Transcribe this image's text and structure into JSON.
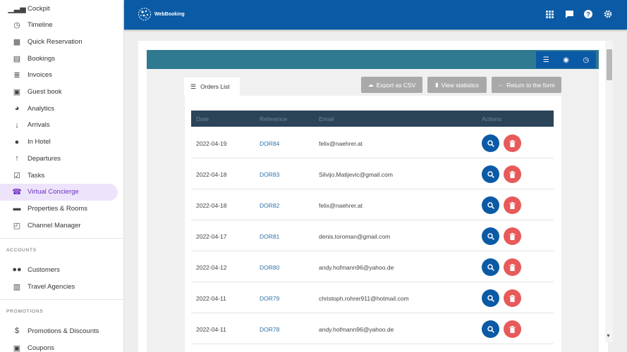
{
  "sidebar": {
    "items": [
      {
        "label": "Cockpit",
        "icon": "bar-chart-icon",
        "glyph": "▁▃▅"
      },
      {
        "label": "Timeline",
        "icon": "clock-icon",
        "glyph": "◷"
      },
      {
        "label": "Quick Reservation",
        "icon": "calendar-icon",
        "glyph": "▦"
      },
      {
        "label": "Bookings",
        "icon": "book-icon",
        "glyph": "▤"
      },
      {
        "label": "Invoices",
        "icon": "invoice-icon",
        "glyph": "≣"
      },
      {
        "label": "Guest book",
        "icon": "guestbook-icon",
        "glyph": "▣"
      },
      {
        "label": "Analytics",
        "icon": "pie-chart-icon",
        "glyph": "◕"
      },
      {
        "label": "Arrivals",
        "icon": "arrow-down-icon",
        "glyph": "↓"
      },
      {
        "label": "In Hotel",
        "icon": "location-pin-icon",
        "glyph": "●"
      },
      {
        "label": "Departures",
        "icon": "arrow-up-icon",
        "glyph": "↑"
      },
      {
        "label": "Tasks",
        "icon": "checklist-icon",
        "glyph": "☑"
      },
      {
        "label": "Virtual Concierge",
        "icon": "concierge-icon",
        "glyph": "☎"
      },
      {
        "label": "Properties & Rooms",
        "icon": "bed-icon",
        "glyph": "▬"
      },
      {
        "label": "Channel Manager",
        "icon": "cast-icon",
        "glyph": "◰"
      }
    ],
    "accounts_label": "ACCOUNTS",
    "accounts": [
      {
        "label": "Customers",
        "icon": "people-icon",
        "glyph": "●●"
      },
      {
        "label": "Travel Agencies",
        "icon": "building-icon",
        "glyph": "▥"
      }
    ],
    "promotions_label": "PROMOTIONS",
    "promotions": [
      {
        "label": "Promotions & Discounts",
        "icon": "dollar-icon",
        "glyph": "$"
      },
      {
        "label": "Coupons",
        "icon": "coupon-icon",
        "glyph": "▣"
      }
    ]
  },
  "header": {
    "logo_text": "WebBooking",
    "icons": [
      "apps-grid-icon",
      "feedback-icon",
      "help-icon",
      "settings-gear-icon"
    ],
    "glyphs": [
      "⋮⋮⋮",
      "▮",
      "?",
      "⚙"
    ]
  },
  "panel": {
    "icons": [
      "list-icon",
      "eye-icon",
      "clock-icon"
    ],
    "glyphs": [
      "☰",
      "◉",
      "◷"
    ]
  },
  "tab": {
    "label": "Orders List",
    "glyph": "☰"
  },
  "toolbar": {
    "export_label": "Export as CSV",
    "stats_label": "View statistics",
    "return_label": "Return to the form"
  },
  "table": {
    "headers": [
      "Date",
      "Reference",
      "Email",
      "Actions"
    ],
    "rows": [
      {
        "date": "2022-04-19",
        "ref": "DOR84",
        "email": "felix@naehrer.at"
      },
      {
        "date": "2022-04-18",
        "ref": "DOR83",
        "email": "Silvijo.Matijevic@gmail.com"
      },
      {
        "date": "2022-04-18",
        "ref": "DOR82",
        "email": "felix@naehrer.at"
      },
      {
        "date": "2022-04-17",
        "ref": "DOR81",
        "email": "denis.toroman@gmail.com"
      },
      {
        "date": "2022-04-12",
        "ref": "DOR80",
        "email": "andy.hofmann96@yahoo.de"
      },
      {
        "date": "2022-04-11",
        "ref": "DOR79",
        "email": "christoph.rohrer911@hotmail.com"
      },
      {
        "date": "2022-04-11",
        "ref": "DOR78",
        "email": "andy.hofmann96@yahoo.de"
      }
    ]
  },
  "colors": {
    "header_blue": "#0b5aa6",
    "panel_teal": "#2f7991",
    "table_header": "#2c4458",
    "delete_red": "#e85a5a",
    "active_purple": "#6b2fbf"
  }
}
